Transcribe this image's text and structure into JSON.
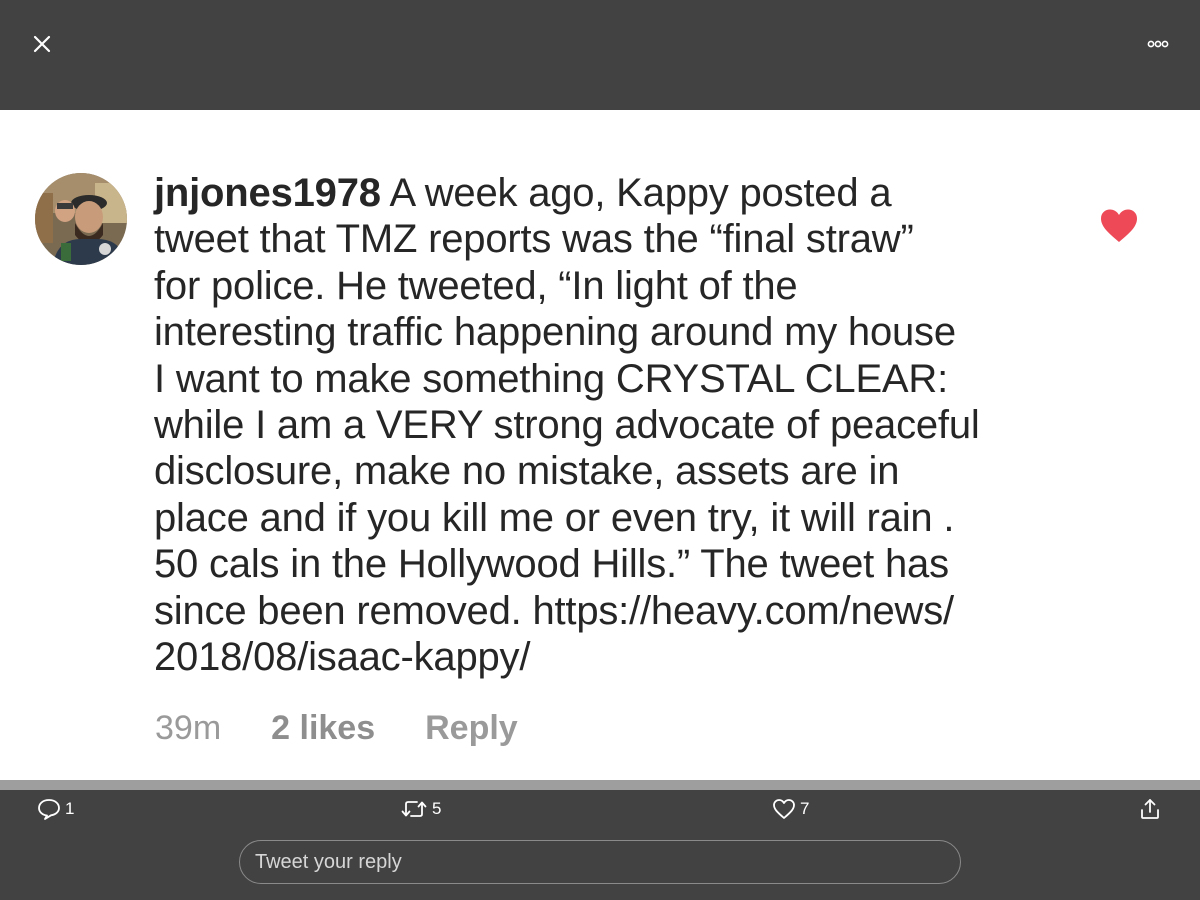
{
  "comment": {
    "username": "jnjones1978",
    "text_lines": [
      "A week ago, Kappy posted a",
      "tweet that TMZ reports was the “final straw”",
      "for police. He tweeted, “In light of the",
      "interesting traffic happening around my house",
      "I want to make something CRYSTAL CLEAR:",
      "while I am a VERY strong advocate of peaceful",
      "disclosure, make no mistake, assets are in",
      "place and if you kill me or even try, it will rain .",
      "50 cals in the Hollywood Hills.” The tweet has",
      "since been removed.  https://heavy.com/news/",
      "2018/08/isaac-kappy/"
    ],
    "time": "39m",
    "likes": "2 likes",
    "reply_label": "Reply"
  },
  "actions": {
    "reply_count": "1",
    "retweet_count": "5",
    "like_count": "7"
  },
  "reply_box": {
    "placeholder": "Tweet your reply"
  },
  "icons": {
    "close": "close-icon",
    "more": "more-icon",
    "heart": "heart-icon",
    "reply": "reply-icon",
    "retweet": "retweet-icon",
    "like": "like-icon",
    "share": "share-icon"
  },
  "colors": {
    "top_bar": "#424242",
    "heart": "#ed4956",
    "text": "#262626",
    "meta": "#9a9a9a"
  }
}
